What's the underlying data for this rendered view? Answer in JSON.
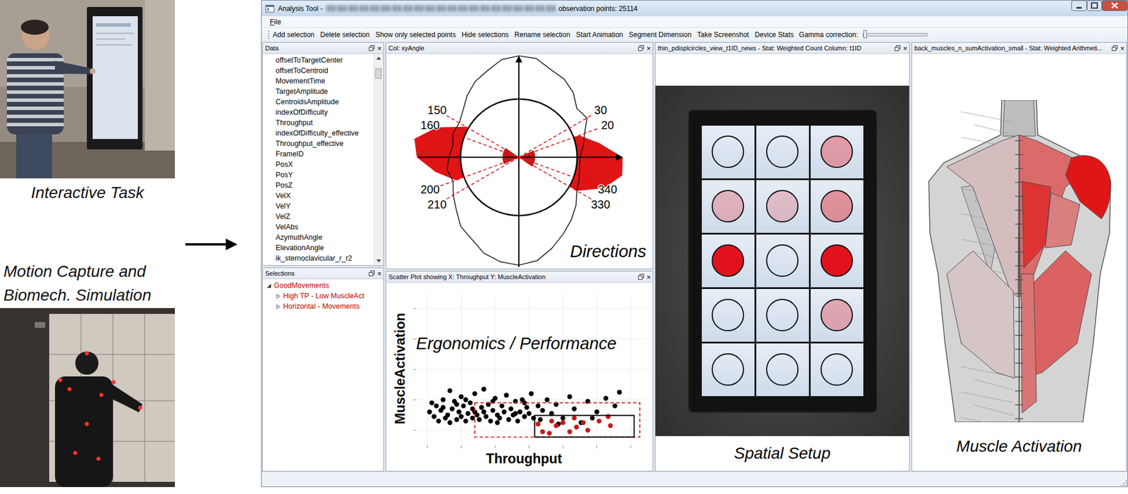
{
  "captions": {
    "interactive_task": "Interactive Task",
    "motion_capture": [
      "Motion Capture and",
      "Biomech. Simulation"
    ]
  },
  "window": {
    "title": "Analysis Tool - ",
    "subtitle": "observation points: 25114"
  },
  "menu": [
    "File"
  ],
  "toolbar": {
    "buttons": [
      "Add selection",
      "Delete selection",
      "Show only selected points",
      "Hide selections",
      "Rename selection",
      "Start Animation",
      "Segment Dimension",
      "Take Screenshot",
      "Device Stats"
    ],
    "gamma": {
      "label": "Gamma correction:",
      "level": 0.03
    }
  },
  "data_panel": {
    "title": "Data",
    "close": "×",
    "scrollbar": {
      "level": 0.03
    },
    "items": [
      "offsetToTargetCenter",
      "offsetToCentroid",
      "MovementTime",
      "TargetAmplitude",
      "CentroidsAmplitude",
      "indexOfDifficulty",
      "Throughput",
      "indexOfDifficulty_effective",
      "Throughput_effective",
      "FrameID",
      "PosX",
      "PosY",
      "PosZ",
      "VelX",
      "VelY",
      "VelZ",
      "VelAbs",
      "AzymuthAngle",
      "ElevationAngle",
      "ik_sternoclavicular_r_r2"
    ]
  },
  "selections_panel": {
    "title": "Selections",
    "close": "×",
    "tree": [
      {
        "label": "GoodMovements",
        "expanded": true,
        "children": [
          {
            "label": "High TP - Low MuscleAct",
            "expanded": false
          },
          {
            "label": "Horizontal - Movements",
            "expanded": false
          }
        ]
      }
    ]
  },
  "directions_panel": {
    "title": "Col: xyAngle",
    "close": "×",
    "caption": "Directions",
    "bins_deg": 10,
    "all": [
      1.05,
      1.12,
      1.2,
      1.35,
      1.3,
      1.45,
      1.55,
      1.6,
      1.72,
      1.74,
      1.7,
      1.58,
      1.5,
      1.38,
      1.25,
      1.18,
      1.2,
      1.15,
      1.2,
      1.25,
      1.2,
      1.3,
      1.4,
      1.55,
      1.62,
      1.75,
      1.82,
      1.85,
      1.8,
      1.66,
      1.52,
      1.4,
      1.28,
      1.15,
      1.1,
      1.06
    ],
    "selected": [
      1.78,
      1.4,
      1.1,
      0,
      0,
      0,
      0,
      0,
      0,
      0,
      0,
      0,
      0,
      0,
      0,
      1.05,
      1.5,
      1.82,
      1.75,
      1.45,
      1.15,
      0,
      0,
      0,
      0,
      0,
      0,
      0,
      0,
      0,
      0,
      0,
      0,
      1.15,
      1.55,
      1.8
    ],
    "boundaries": [
      {
        "angle": 30,
        "label": "30"
      },
      {
        "angle": 20,
        "label": "20"
      },
      {
        "angle": 150,
        "label": "150"
      },
      {
        "angle": 160,
        "label": "160"
      },
      {
        "angle": 200,
        "label": "200"
      },
      {
        "angle": 210,
        "label": "210"
      },
      {
        "angle": 340,
        "label": "340"
      },
      {
        "angle": 330,
        "label": "330"
      }
    ]
  },
  "scatter_panel": {
    "title": "Scatter Plot showing X: Throughput Y: MuscleActivation",
    "close": "×",
    "caption": "Ergonomics / Performance",
    "x_label": "Throughput",
    "y_label": "MuscleActivation",
    "series": [
      {
        "color": "#000000",
        "points": [
          [
            0.6,
            2.2
          ],
          [
            0.8,
            1.9
          ],
          [
            0.9,
            2.6
          ],
          [
            1.0,
            1.6
          ],
          [
            1.1,
            2.3
          ],
          [
            1.2,
            3.0
          ],
          [
            1.3,
            1.8
          ],
          [
            1.4,
            2.0
          ],
          [
            1.5,
            3.6
          ],
          [
            1.5,
            1.5
          ],
          [
            1.6,
            2.4
          ],
          [
            1.7,
            2.9
          ],
          [
            1.8,
            1.7
          ],
          [
            1.9,
            2.2
          ],
          [
            2.0,
            1.9
          ],
          [
            2.0,
            3.2
          ],
          [
            2.1,
            2.6
          ],
          [
            2.2,
            1.6
          ],
          [
            2.3,
            2.1
          ],
          [
            2.4,
            2.8
          ],
          [
            2.5,
            1.8
          ],
          [
            2.5,
            2.4
          ],
          [
            2.6,
            3.4
          ],
          [
            2.7,
            2.0
          ],
          [
            2.8,
            1.7
          ],
          [
            2.9,
            2.5
          ],
          [
            3.0,
            2.2
          ],
          [
            3.0,
            3.7
          ],
          [
            3.1,
            1.9
          ],
          [
            3.2,
            2.7
          ],
          [
            3.3,
            1.6
          ],
          [
            3.4,
            2.3
          ],
          [
            3.5,
            3.1
          ],
          [
            3.6,
            2.0
          ],
          [
            3.7,
            1.8
          ],
          [
            3.8,
            2.6
          ],
          [
            3.9,
            2.2
          ],
          [
            4.0,
            3.3
          ],
          [
            4.1,
            1.7
          ],
          [
            4.2,
            2.4
          ],
          [
            4.3,
            2.0
          ],
          [
            4.4,
            2.9
          ],
          [
            4.5,
            1.6
          ],
          [
            4.6,
            2.2
          ],
          [
            4.7,
            3.0
          ],
          [
            4.8,
            1.9
          ],
          [
            4.9,
            2.5
          ],
          [
            5.0,
            2.1
          ],
          [
            5.1,
            3.4
          ],
          [
            5.2,
            1.8
          ],
          [
            5.4,
            2.6
          ],
          [
            5.6,
            2.3
          ],
          [
            5.8,
            3.0
          ],
          [
            6.0,
            2.1
          ],
          [
            6.2,
            2.7
          ],
          [
            6.5,
            1.8
          ],
          [
            6.8,
            3.2
          ],
          [
            7.0,
            2.4
          ],
          [
            7.3,
            1.5
          ],
          [
            7.6,
            2.9
          ],
          [
            8.0,
            2.2
          ],
          [
            8.4,
            3.1
          ],
          [
            8.8,
            2.6
          ],
          [
            9.0,
            3.5
          ],
          [
            0.7,
            2.8
          ],
          [
            1.2,
            2.5
          ],
          [
            1.8,
            2.7
          ],
          [
            2.2,
            3.0
          ],
          [
            2.6,
            2.2
          ],
          [
            3.4,
            2.9
          ],
          [
            3.6,
            1.5
          ],
          [
            4.4,
            2.1
          ],
          [
            4.8,
            2.8
          ],
          [
            5.5,
            1.7
          ],
          [
            6.3,
            1.4
          ],
          [
            7.8,
            1.8
          ]
        ]
      },
      {
        "color": "#c41a1a",
        "points": [
          [
            5.4,
            1.4
          ],
          [
            5.6,
            0.9
          ],
          [
            5.9,
            0.8
          ],
          [
            6.2,
            1.3
          ],
          [
            6.5,
            1.5
          ],
          [
            6.8,
            0.9
          ],
          [
            7.1,
            1.2
          ],
          [
            7.4,
            1.5
          ],
          [
            7.6,
            1.0
          ],
          [
            8.1,
            1.6
          ],
          [
            8.5,
            1.9
          ],
          [
            8.6,
            1.3
          ],
          [
            7.0,
            1.8
          ],
          [
            6.0,
            1.6
          ]
        ]
      }
    ],
    "selections": [
      {
        "kind": "dashed",
        "color": "#d42a2a",
        "x0": 2.6,
        "x1": 9.9,
        "y0": 0.55,
        "y1": 2.8
      },
      {
        "kind": "solid",
        "color": "#000000",
        "x0": 5.25,
        "x1": 9.65,
        "y0": 0.55,
        "y1": 1.97
      }
    ]
  },
  "spatial_panel": {
    "title": "thin_pdisplcircles_view_t1ID_news - Stat: Weighted Count Column: t1ID",
    "close": "×",
    "caption": "Spatial Setup",
    "cells": [
      {
        "level": 0
      },
      {
        "level": 0
      },
      {
        "level": 0.35
      },
      {
        "level": 0.25
      },
      {
        "level": 0.2
      },
      {
        "level": 0.4
      },
      {
        "level": 1
      },
      {
        "level": 0
      },
      {
        "level": 1
      },
      {
        "level": 0
      },
      {
        "level": 0
      },
      {
        "level": 0.3
      },
      {
        "level": 0
      },
      {
        "level": 0
      },
      {
        "level": 0
      }
    ]
  },
  "muscle_panel": {
    "title": "back_muscles_n_sumActivation_small - Stat: Weighted Arithmeti...",
    "close": "×",
    "caption": "Muscle Activation",
    "muscles": [
      {
        "kind": "trapezius-left",
        "level": 0.12
      },
      {
        "kind": "latissimus-left",
        "level": 0.08
      },
      {
        "kind": "trapezius-right",
        "level": 0.55
      },
      {
        "kind": "latissimus-right",
        "level": 0.6
      },
      {
        "kind": "infraspinatus-right",
        "level": 0.45
      },
      {
        "kind": "rhomboid-right",
        "level": 0.85
      },
      {
        "kind": "erector-right",
        "level": 0.5
      },
      {
        "kind": "deltoid-right",
        "level": 1.0
      }
    ]
  }
}
